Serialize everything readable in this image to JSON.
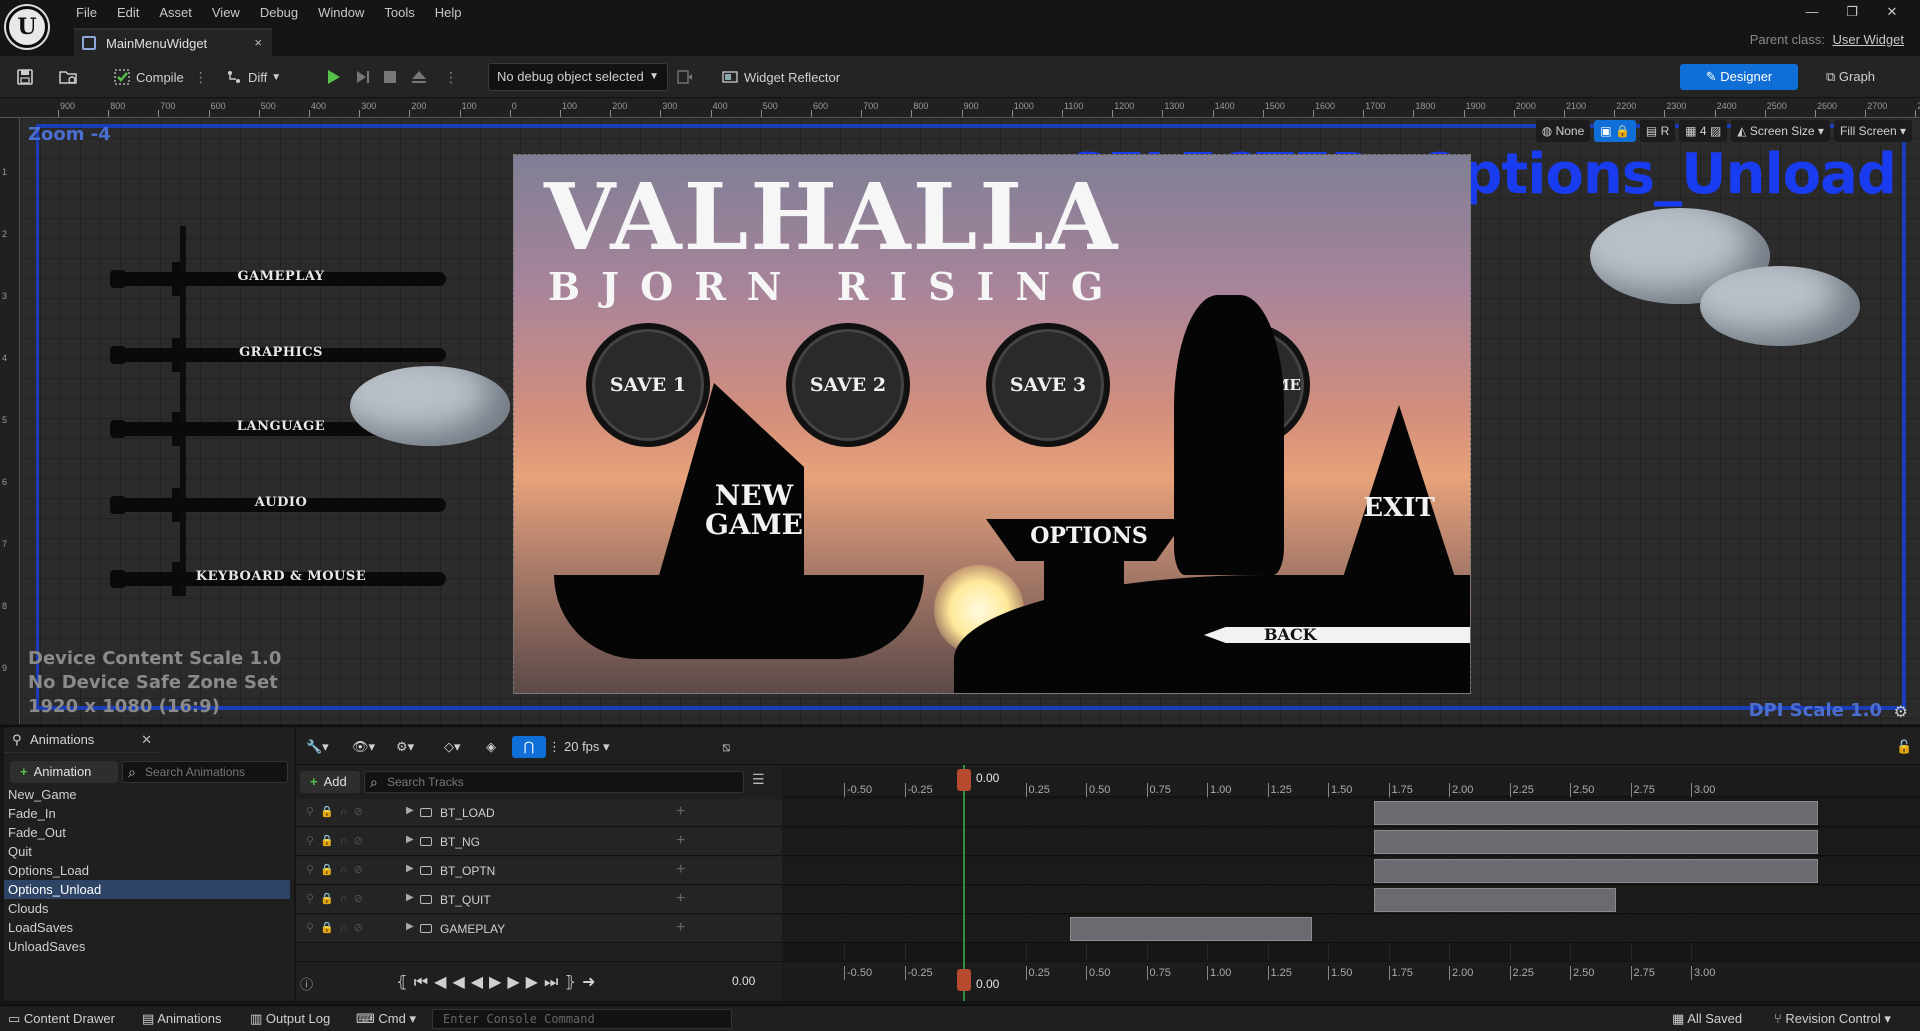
{
  "menubar": {
    "logo": "U",
    "items": [
      "File",
      "Edit",
      "Asset",
      "View",
      "Debug",
      "Window",
      "Tools",
      "Help"
    ],
    "parent_class_label": "Parent class:",
    "parent_class_value": "User Widget"
  },
  "tab": {
    "title": "MainMenuWidget",
    "close": "×"
  },
  "toolbar": {
    "compile": "Compile",
    "diff": "Diff",
    "debug_object": "No debug object selected",
    "widget_reflector": "Widget Reflector",
    "designer": "Designer",
    "graph": "Graph"
  },
  "viewport": {
    "zoom": "Zoom -4",
    "device_content_scale": "Device Content Scale 1.0",
    "safe_zone": "No Device Safe Zone Set",
    "resolution": "1920 x 1080 (16:9)",
    "dpi_scale": "DPI Scale 1.0",
    "selected": "SELECTED: Options_Unload",
    "tools": {
      "none": "None",
      "r": "R",
      "grid_count": "4",
      "screen_size": "Screen Size",
      "fill_screen": "Fill Screen"
    },
    "ruler_top": [
      "900",
      "800",
      "700",
      "600",
      "500",
      "400",
      "300",
      "200",
      "100",
      "0",
      "100",
      "200",
      "300",
      "400",
      "500",
      "600",
      "700",
      "800",
      "900",
      "1000",
      "1100",
      "1200",
      "1300",
      "1400",
      "1500",
      "1600",
      "1700",
      "1800",
      "1900",
      "2000",
      "2100",
      "2200",
      "2300",
      "2400",
      "2500",
      "2600",
      "2700",
      "280"
    ],
    "ruler_left": [
      "1",
      "2",
      "3",
      "4",
      "5",
      "6",
      "7",
      "8",
      "9"
    ]
  },
  "options_menu": {
    "items": [
      "GAMEPLAY",
      "GRAPHICS",
      "LANGUAGE",
      "AUDIO",
      "KEYBOARD & MOUSE"
    ]
  },
  "game": {
    "title": "VALHALLA",
    "subtitle": "BJORN RISING",
    "saves": [
      "SAVE 1",
      "SAVE 2",
      "SAVE 3",
      "LOAD GAME"
    ],
    "new_game": "NEW GAME",
    "options": "OPTIONS",
    "exit": "EXIT",
    "back": "BACK"
  },
  "animations": {
    "tab_title": "Animations",
    "add_button": "Animation",
    "search_placeholder": "Search Animations",
    "items": [
      "New_Game",
      "Fade_In",
      "Fade_Out",
      "Quit",
      "Options_Load",
      "Options_Unload",
      "Clouds",
      "LoadSaves",
      "UnloadSaves"
    ],
    "selected_index": 5
  },
  "sequencer": {
    "fps": "20 fps",
    "add_button": "Add",
    "search_placeholder": "Search Tracks",
    "tracks": [
      "BT_LOAD",
      "BT_NG",
      "BT_OPTN",
      "BT_QUIT",
      "GAMEPLAY"
    ],
    "current_time": "0.00",
    "playhead_label": "0.00",
    "time_ticks": [
      "-0.50",
      "-0.25",
      "0.25",
      "0.50",
      "0.75",
      "1.00",
      "1.25",
      "1.50",
      "1.75",
      "2.00",
      "2.25",
      "2.50",
      "2.75",
      "3.00"
    ]
  },
  "statusbar": {
    "content_drawer": "Content Drawer",
    "animations": "Animations",
    "output_log": "Output Log",
    "cmd": "Cmd",
    "console_placeholder": "Enter Console Command",
    "all_saved": "All Saved",
    "revision_control": "Revision Control"
  },
  "colors": {
    "accent": "#0f6fd6",
    "selected_blue": "#1a3cf0",
    "frame_blue": "#1a3cb8",
    "playhead_green": "#2f8f3f"
  }
}
